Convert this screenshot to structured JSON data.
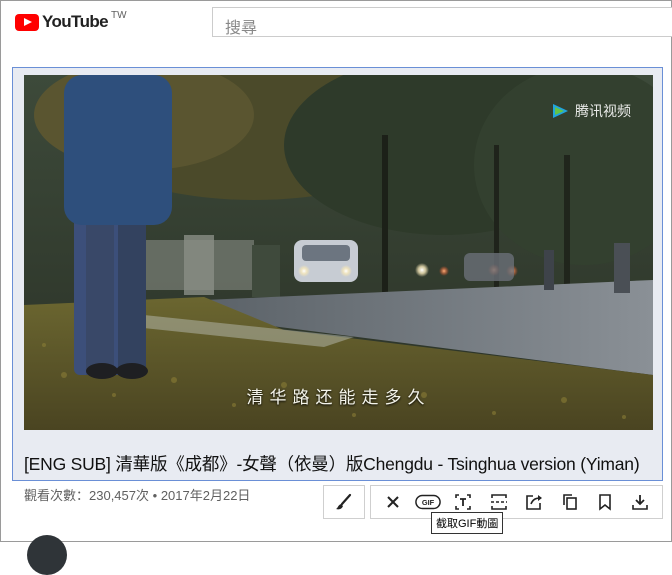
{
  "header": {
    "logo_text": "YouTube",
    "country_code": "TW",
    "search_placeholder": "搜尋"
  },
  "player": {
    "watermark_text": "腾讯视频",
    "subtitle": "清华路还能走多久"
  },
  "video": {
    "title": "[ENG SUB] 清華版《成都》-女聲（依曼）版Chengdu - Tsinghua version (Yiman)",
    "view_count": "觀看次數：230,457次",
    "upload_date": "2017年2月22日",
    "meta_separator": "•"
  },
  "toolbar": {
    "tools": [
      "brush-icon",
      "close-icon",
      "gif-icon",
      "text-crop-icon",
      "expand-icon",
      "share-icon",
      "copy-icon",
      "bookmark-icon",
      "download-icon"
    ],
    "gif_badge": "GIF",
    "tooltip": "截取GIF動圖"
  },
  "colors": {
    "brand": "#ff0000",
    "selection_border": "#6a8fd6"
  }
}
